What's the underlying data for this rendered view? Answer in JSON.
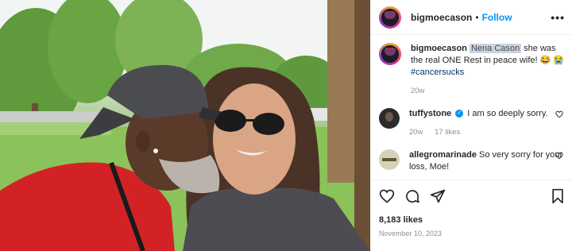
{
  "post": {
    "author": "bigmoecason",
    "follow_label": "Follow",
    "separator": "•",
    "more_label": "•••"
  },
  "caption": {
    "user": "bigmoecason",
    "mention": "Nena Cason",
    "text": " she was the real ONE Rest in peace wife! 😂 😭",
    "hashtag": "#cancersucks",
    "time": "20w"
  },
  "comments": [
    {
      "user": "tuffystone",
      "verified": true,
      "text": "I am so deeply sorry.",
      "time": "20w",
      "likes": "17 likes"
    },
    {
      "user": "allegromarinade",
      "verified": false,
      "text": "So very sorry for your loss, Moe!"
    }
  ],
  "actions": {
    "likes": "8,183 likes",
    "date": "November 10, 2023"
  },
  "icons": [
    "heart-icon",
    "comment-icon",
    "share-icon",
    "bookmark-icon"
  ],
  "colors": {
    "link": "#0095f6",
    "hashtag": "#00376b",
    "meta": "#8e8e8e"
  }
}
